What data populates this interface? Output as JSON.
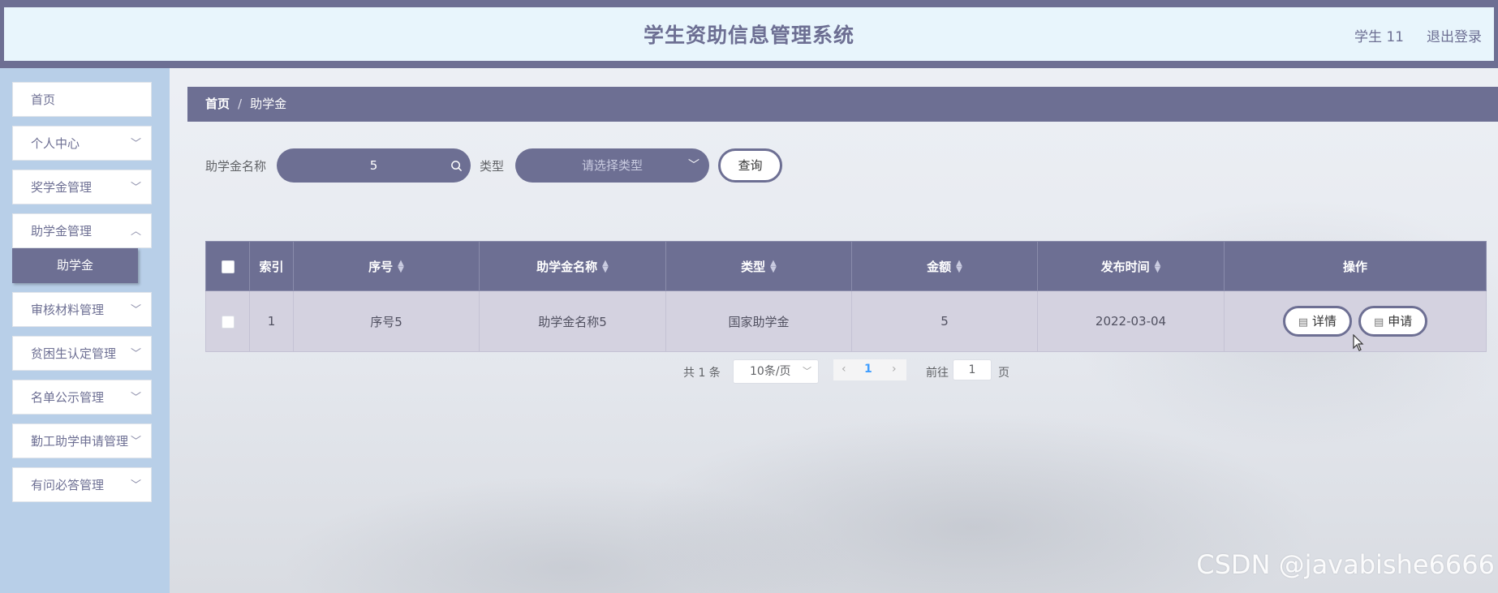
{
  "header": {
    "title": "学生资助信息管理系统",
    "user": "学生 11",
    "logout": "退出登录"
  },
  "sidebar": {
    "items": [
      {
        "label": "首页",
        "has_chevron": false
      },
      {
        "label": "个人中心",
        "has_chevron": true
      },
      {
        "label": "奖学金管理",
        "has_chevron": true
      },
      {
        "label": "助学金管理",
        "has_chevron": true
      },
      {
        "label": "审核材料管理",
        "has_chevron": true
      },
      {
        "label": "贫困生认定管理",
        "has_chevron": true
      },
      {
        "label": "名单公示管理",
        "has_chevron": true
      },
      {
        "label": "勤工助学申请管理",
        "has_chevron": true
      },
      {
        "label": "有问必答管理",
        "has_chevron": true
      }
    ],
    "active_sub_item": "助学金"
  },
  "breadcrumb": {
    "home": "首页",
    "separator": "/",
    "current": "助学金"
  },
  "search": {
    "name_label": "助学金名称",
    "name_value": "5",
    "type_label": "类型",
    "type_placeholder": "请选择类型",
    "query_button": "查询"
  },
  "table": {
    "headers": [
      "索引",
      "序号",
      "助学金名称",
      "类型",
      "金额",
      "发布时间",
      "操作"
    ],
    "rows": [
      {
        "index": "1",
        "serial": "序号5",
        "name": "助学金名称5",
        "type": "国家助学金",
        "amount": "5",
        "date": "2022-03-04"
      }
    ],
    "actions": {
      "detail": "详情",
      "apply": "申请"
    }
  },
  "pagination": {
    "total": "共 1 条",
    "page_size": "10条/页",
    "current_page": "1",
    "goto_label": "前往",
    "goto_value": "1",
    "page_unit": "页"
  },
  "watermark": "CSDN @javabishe6666",
  "colors": {
    "accent": "#6d6f93",
    "header_bg": "#e8f5fc",
    "sidebar_bg": "#b8cfe8",
    "row_bg": "#d4d2e0"
  },
  "icons": {
    "search": "search-icon",
    "dropdown": "chevron-down-icon",
    "document": "document-icon"
  }
}
